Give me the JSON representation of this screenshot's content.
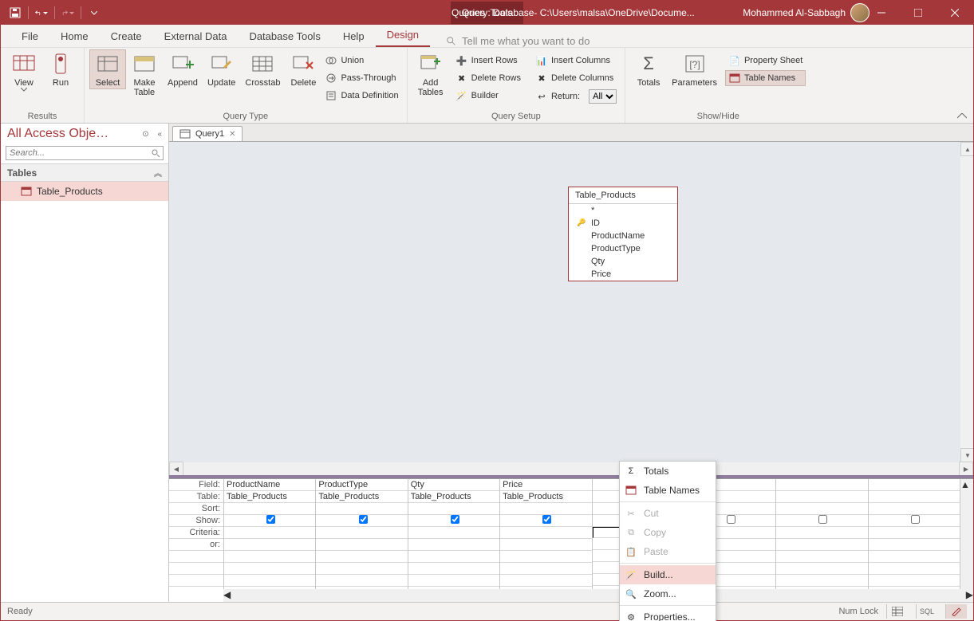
{
  "titlebar": {
    "query_tools": "Query Tools",
    "title": "Queries : Database- C:\\Users\\malsa\\OneDrive\\Docume...",
    "user": "Mohammed Al-Sabbagh"
  },
  "tabs": [
    "File",
    "Home",
    "Create",
    "External Data",
    "Database Tools",
    "Help",
    "Design"
  ],
  "tellme": "Tell me what you want to do",
  "ribbon": {
    "results": {
      "label": "Results",
      "view": "View",
      "run": "Run"
    },
    "querytype": {
      "label": "Query Type",
      "select": "Select",
      "make": "Make\nTable",
      "append": "Append",
      "update": "Update",
      "crosstab": "Crosstab",
      "delete": "Delete",
      "union": "Union",
      "passthrough": "Pass-Through",
      "datadef": "Data Definition"
    },
    "querysetup": {
      "label": "Query Setup",
      "addtables": "Add\nTables",
      "insertrows": "Insert Rows",
      "deleterows": "Delete Rows",
      "builder": "Builder",
      "insertcols": "Insert Columns",
      "deletecols": "Delete Columns",
      "return": "Return:",
      "return_val": "All"
    },
    "showhide": {
      "label": "Show/Hide",
      "totals": "Totals",
      "parameters": "Parameters",
      "propsheet": "Property Sheet",
      "tablenames": "Table Names"
    }
  },
  "nav": {
    "title": "All Access Obje…",
    "search_placeholder": "Search...",
    "group": "Tables",
    "item": "Table_Products"
  },
  "doctab": "Query1",
  "table_card": {
    "name": "Table_Products",
    "fields": [
      "*",
      "ID",
      "ProductName",
      "ProductType",
      "Qty",
      "Price"
    ]
  },
  "grid": {
    "rowlabels": [
      "Field:",
      "Table:",
      "Sort:",
      "Show:",
      "Criteria:",
      "or:"
    ],
    "cols": [
      {
        "field": "ProductName",
        "table": "Table_Products",
        "show": true
      },
      {
        "field": "ProductType",
        "table": "Table_Products",
        "show": true
      },
      {
        "field": "Qty",
        "table": "Table_Products",
        "show": true
      },
      {
        "field": "Price",
        "table": "Table_Products",
        "show": true
      },
      {
        "field": "",
        "table": "",
        "show": false
      },
      {
        "field": "",
        "table": "",
        "show": false
      },
      {
        "field": "",
        "table": "",
        "show": false
      },
      {
        "field": "",
        "table": "",
        "show": false
      }
    ]
  },
  "ctx": {
    "totals": "Totals",
    "tablenames": "Table Names",
    "cut": "Cut",
    "copy": "Copy",
    "paste": "Paste",
    "build": "Build...",
    "zoom": "Zoom...",
    "properties": "Properties..."
  },
  "status": {
    "ready": "Ready",
    "numlock": "Num Lock",
    "sql": "SQL"
  }
}
